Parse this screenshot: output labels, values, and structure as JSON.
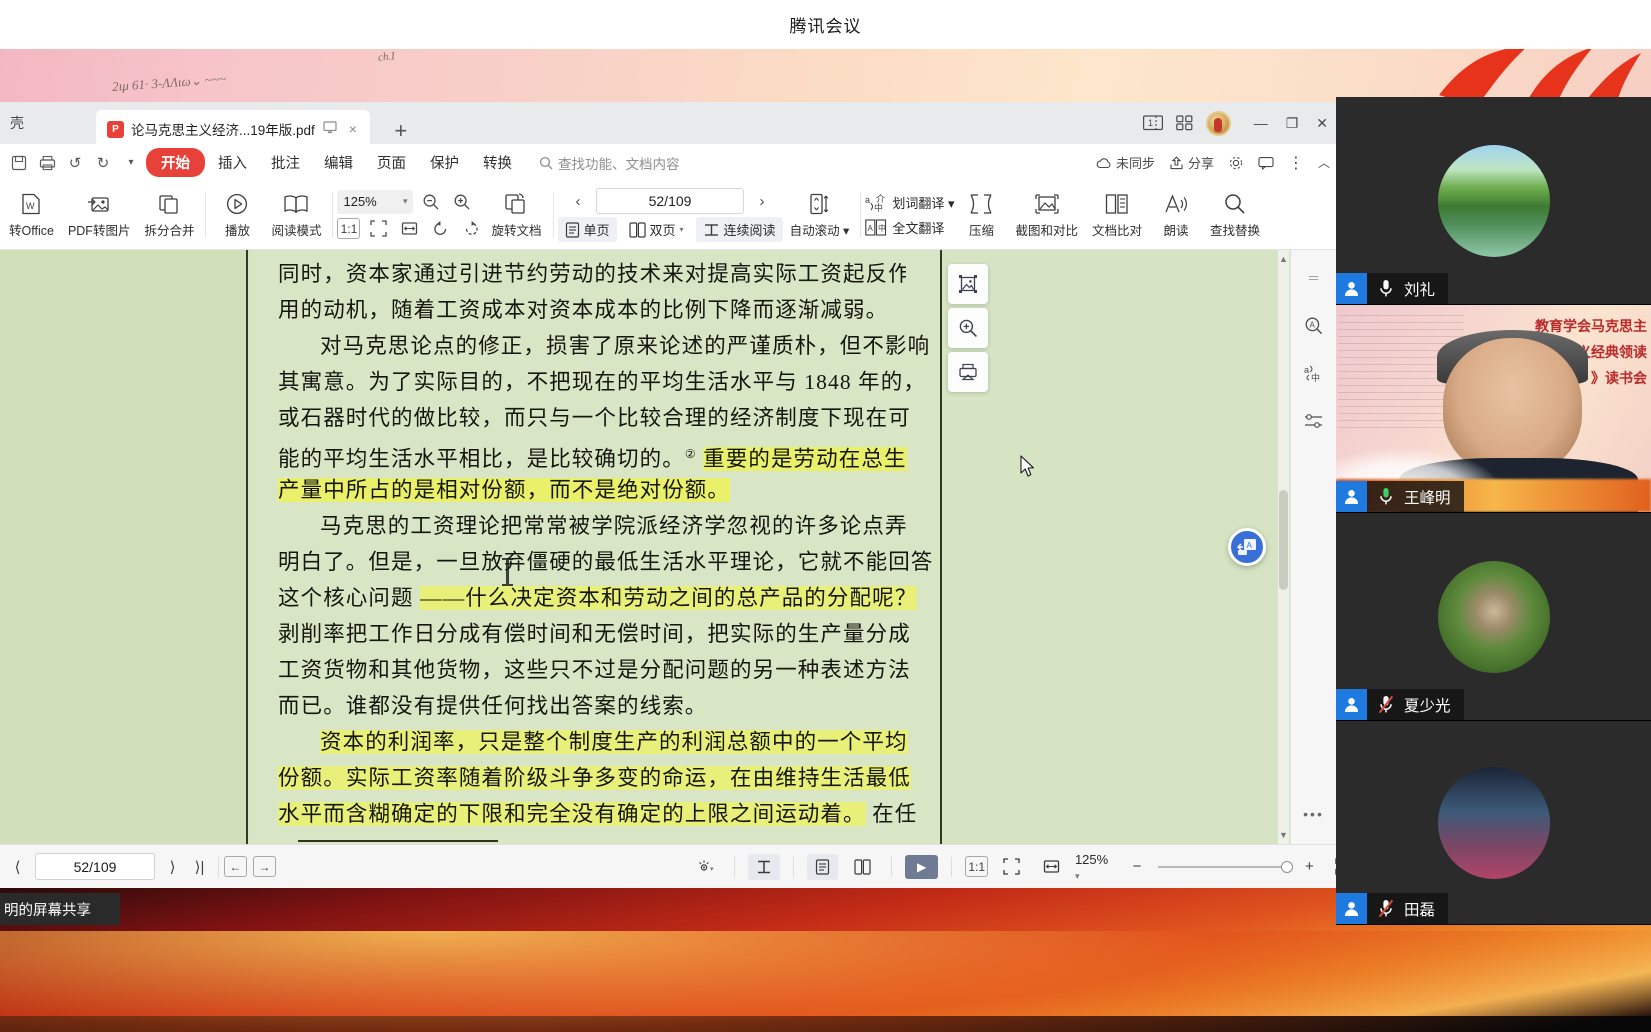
{
  "meeting": {
    "title": "腾讯会议",
    "share_label": "明的屏幕共享"
  },
  "wps": {
    "tab_prev_label": "壳",
    "document_tab": {
      "name": "论马克思主义经济...19年版.pdf",
      "file_type": "PDF",
      "pdf_badge": "P",
      "cast_icon": "monitor-cast-icon",
      "close_icon": "×"
    },
    "new_tab_icon": "+",
    "title_right": {
      "page_view_icon": "1",
      "grid_icon": "grid-icon",
      "account_icon": "account-avatar",
      "minimize": "—",
      "restore": "❐",
      "close": "✕"
    },
    "quick_access": [
      "save-icon",
      "print-icon",
      "undo-icon",
      "redo-icon",
      "more-icon"
    ],
    "menu_tabs": [
      {
        "label": "开始",
        "active": true
      },
      {
        "label": "插入",
        "active": false
      },
      {
        "label": "批注",
        "active": false
      },
      {
        "label": "编辑",
        "active": false
      },
      {
        "label": "页面",
        "active": false
      },
      {
        "label": "保护",
        "active": false
      },
      {
        "label": "转换",
        "active": false
      }
    ],
    "search": {
      "placeholder": "查找功能、文档内容",
      "icon": "search-icon"
    },
    "menu_right": [
      {
        "label": "未同步",
        "icon": "cloud-sync-icon"
      },
      {
        "label": "分享",
        "icon": "share-icon"
      },
      {
        "label": "",
        "icon": "settings-gear-icon"
      },
      {
        "label": "",
        "icon": "comment-icon"
      },
      {
        "label": "",
        "icon": "more-dots-icon"
      },
      {
        "label": "",
        "icon": "collapse-chevron-icon"
      }
    ],
    "ribbon": {
      "to_office": "转Office",
      "pdf_to_image": "PDF转图片",
      "split_merge": "拆分合并",
      "play": "播放",
      "read_mode": "阅读模式",
      "zoom_value": "125%",
      "rotate_doc": "旋转文档",
      "page_indicator": "52/109",
      "auto_scroll": "自动滚动",
      "view_single": "单页",
      "view_double": "双页",
      "view_continuous": "连续阅读",
      "word_translate": "划词翻译",
      "full_translate": "全文翻译",
      "compress": "压缩",
      "screenshot_compare": "截图和对比",
      "doc_compare": "文档比对",
      "read_aloud": "朗读",
      "find_replace": "查找替换",
      "fit_labels": [
        "1:1",
        "fit-page-icon",
        "fit-width-icon",
        "rotate-left-icon",
        "rotate-right-icon"
      ]
    },
    "page_tools": [
      "image-extract-icon",
      "zoom-area-icon",
      "print-area-icon"
    ],
    "fab_icon": "translate-doc-icon",
    "right_rail": [
      "search-in-doc-icon",
      "translate-icon",
      "settings-sliders-icon",
      "more-dots-icon"
    ],
    "statusbar": {
      "page_indicator": "52/109",
      "first_page_icon": "⟨",
      "next_page_icon": "⟩",
      "last_page_icon": "⟩|",
      "back_icon": "←",
      "forward_icon": "→",
      "eye_icon": "reading-theme-icon",
      "continuous_icon": "continuous-scroll-icon",
      "single_page_icon": "single-page-icon",
      "double_page_icon": "double-page-icon",
      "play_icon": "▶",
      "actual_size_label": "1:1",
      "fit_page_icon": "fit-page-icon",
      "fit_width_icon": "fit-width-icon",
      "zoom_value": "125%",
      "zoom_out": "−",
      "zoom_in": "+",
      "fullscreen_icon": "fullscreen-icon"
    }
  },
  "document": {
    "lines": [
      {
        "text": "同时，资本家通过引进节约劳动的技术来对提高实际工资起反作",
        "indent": false,
        "highlight": "none",
        "clipped": true
      },
      {
        "text": "用的动机，随着工资成本对资本成本的比例下降而逐渐减弱。",
        "indent": false,
        "highlight": "none"
      },
      {
        "text": "对马克思论点的修正，损害了原来论述的严谨质朴，但不影响",
        "indent": true,
        "highlight": "none"
      },
      {
        "text": "其寓意。为了实际目的，不把现在的平均生活水平与 1848 年的，",
        "indent": false,
        "highlight": "none"
      },
      {
        "text": "或石器时代的做比较，而只与一个比较合理的经济制度下现在可",
        "indent": false,
        "highlight": "none"
      },
      {
        "text": "能的平均生活水平相比，是比较确切的。",
        "indent": false,
        "highlight": "partial-end",
        "tail": "重要的是劳动在总生"
      },
      {
        "text": "产量中所占的是相对份额，而不是绝对份额。",
        "indent": false,
        "highlight": "full"
      },
      {
        "text": "马克思的工资理论把常常被学院派经济学忽视的许多论点弄",
        "indent": true,
        "highlight": "none"
      },
      {
        "text": "明白了。但是，一旦放弃僵硬的最低生活水平理论，它就不能回答",
        "indent": false,
        "highlight": "none"
      },
      {
        "text": "这个核心问题",
        "indent": false,
        "highlight": "partial-end",
        "tail": "——什么决定资本和劳动之间的总产品的分配呢？"
      },
      {
        "text": "剥削率把工作日分成有偿时间和无偿时间，把实际的生产量分成",
        "indent": false,
        "highlight": "none"
      },
      {
        "text": "工资货物和其他货物，这些只不过是分配问题的另一种表述方法",
        "indent": false,
        "highlight": "none"
      },
      {
        "text": "而已。谁都没有提供任何找出答案的线索。",
        "indent": false,
        "highlight": "none"
      },
      {
        "text": "资本的利润率，只是整个制度生产的利润总额中的一个平均",
        "indent": true,
        "highlight": "full"
      },
      {
        "text": "份额。",
        "indent": false,
        "highlight": "partial-start",
        "tail": "实际工资率随着阶级斗争多变的命运，在由维持生活最低"
      },
      {
        "text": "水平而含糊确定的下限和完全没有确定的上限之间运动着。",
        "indent": false,
        "highlight": "full",
        "tail": "在任"
      }
    ],
    "footnote_marker": "②"
  },
  "participants": [
    {
      "name": "刘礼",
      "muted": false,
      "avatar": "lake-photo"
    },
    {
      "name": "王峰明",
      "muted": false,
      "speaking": true,
      "avatar": "speaker-video",
      "banner_lines": [
        "教育学会马克思主",
        "义经典领读",
        "》读书会"
      ]
    },
    {
      "name": "夏少光",
      "muted": true,
      "avatar": "owl-photo"
    },
    {
      "name": "田磊",
      "muted": true,
      "avatar": "anime-photo"
    }
  ],
  "colors": {
    "accent_red": "#e8413a",
    "page_bg": "#d9e6c6",
    "highlight_yellow": "#eaf06a",
    "mic_active": "#3fd06a",
    "mic_muted": "#d64a3a",
    "person_badge": "#1f7ae0"
  }
}
